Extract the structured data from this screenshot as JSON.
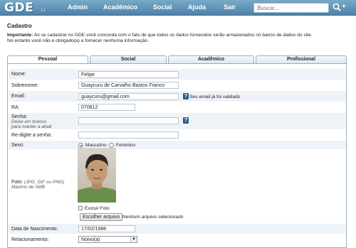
{
  "header": {
    "logo": "GDE",
    "logo_sub": "1.1",
    "nav": [
      "Admin",
      "Acadêmico",
      "Social",
      "Ajuda",
      "Sair"
    ],
    "search_placeholder": "Buscar...",
    "colors": {
      "bar": "#4f82a8",
      "text": "#ffffff"
    }
  },
  "page": {
    "title": "Cadastro",
    "notice_bold": "Importante:",
    "notice_line1": " Ao se cadastrar no GDE você concorda com o fato de que todos os dados fornecidos serão armazenados no banco de dados do site.",
    "notice_line2": "No entanto você não é obrigado(a) a fornecer nenhuma informação."
  },
  "tabs": [
    "Pessoal",
    "Social",
    "Acadêmico",
    "Profissional"
  ],
  "form": {
    "nome": {
      "label": "Nome:",
      "value": "Felipe"
    },
    "sobrenome": {
      "label": "Sobrenome:",
      "value": "Guaycuru de Carvalho Bastos Franco"
    },
    "email": {
      "label": "Email:",
      "value": "guaycuru@gmail.com",
      "note": "Seu email já foi validado"
    },
    "ra": {
      "label": "RA:",
      "value": "070812"
    },
    "senha": {
      "label": "Senha:",
      "hint1": "Deixe em branco",
      "hint2": "para manter a atual",
      "value": ""
    },
    "resenha": {
      "label": "Re-digite a senha:",
      "value": ""
    },
    "sexo": {
      "label": "Sexo:",
      "opt1": "Masculino",
      "opt2": "Feminino",
      "selected": "Masculino"
    },
    "foto": {
      "label": "Foto:",
      "hint1": "(JPG, GIF ou PNG)",
      "hint2": "Máximo de 5MB",
      "excluir": "Excluir Foto",
      "button": "Escolher arquivo",
      "file_status": "Nenhum arquivo selecionado"
    },
    "nascimento": {
      "label": "Data de Nascimento:",
      "value": "17/02/1988"
    },
    "relacionamento": {
      "label": "Relacionamento:",
      "value": "Noivo(a)"
    }
  }
}
